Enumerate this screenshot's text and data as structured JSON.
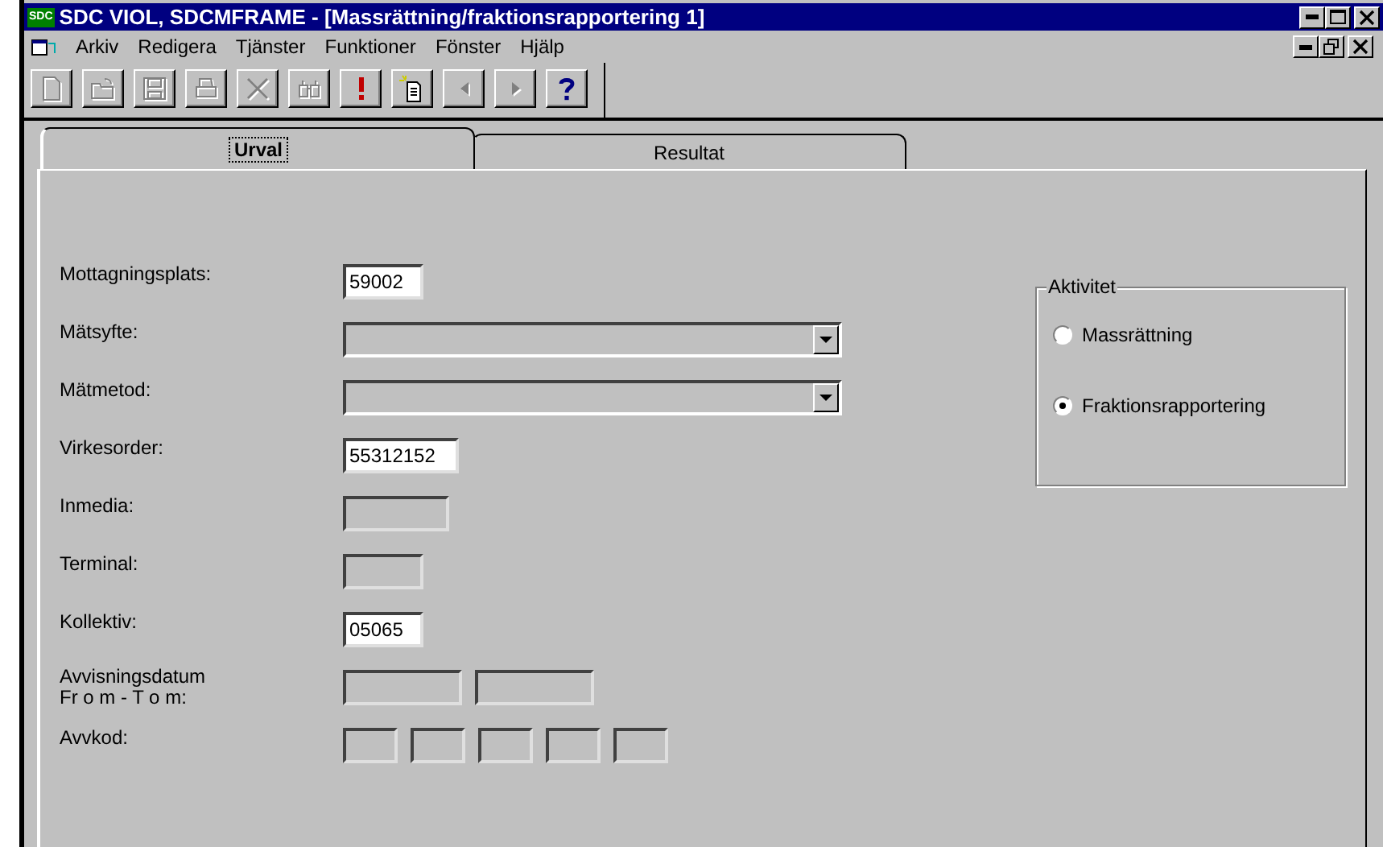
{
  "window": {
    "logo": "SDC",
    "title": "SDC VIOL, SDCMFRAME - [Massrättning/fraktionsrapportering 1]"
  },
  "menu": [
    "Arkiv",
    "Redigera",
    "Tjänster",
    "Funktioner",
    "Fönster",
    "Hjälp"
  ],
  "toolbar": [
    {
      "kind": "new",
      "disabled": true
    },
    {
      "kind": "open",
      "disabled": true
    },
    {
      "kind": "save",
      "disabled": true
    },
    {
      "kind": "print",
      "disabled": true
    },
    {
      "kind": "delete",
      "disabled": true
    },
    {
      "kind": "find",
      "disabled": true
    },
    {
      "kind": "exclaim",
      "disabled": false
    },
    {
      "kind": "newdoc",
      "disabled": false
    },
    {
      "kind": "prev",
      "disabled": true
    },
    {
      "kind": "next",
      "disabled": true
    },
    {
      "kind": "help",
      "disabled": false
    }
  ],
  "tabs": [
    {
      "label": "Urval",
      "selected": true
    },
    {
      "label": "Resultat",
      "selected": false
    }
  ],
  "form": [
    {
      "label": "Mottagningsplats:",
      "kind": "text",
      "fields": [
        {
          "value": "59002",
          "disabled": false
        }
      ]
    },
    {
      "label": "Mätsyfte:",
      "kind": "combo"
    },
    {
      "label": "Mätmetod:",
      "kind": "combo"
    },
    {
      "label": "Virkesorder:",
      "kind": "text",
      "fields": [
        {
          "value": "55312152",
          "disabled": false
        }
      ]
    },
    {
      "label": "Inmedia:",
      "kind": "text",
      "fields": [
        {
          "disabled": true
        }
      ]
    },
    {
      "label": "Terminal:",
      "kind": "text",
      "fields": [
        {
          "disabled": true
        }
      ]
    },
    {
      "label": "Kollektiv:",
      "kind": "text",
      "fields": [
        {
          "value": "05065",
          "disabled": false
        }
      ]
    },
    {
      "label": "Avvisningsdatum\nFr o m - T o m:",
      "kind": "text",
      "fields": [
        {
          "disabled": true
        },
        {
          "disabled": true
        }
      ]
    },
    {
      "label": "Avvkod:",
      "kind": "text",
      "fields": [
        {
          "disabled": true
        },
        {
          "disabled": true
        },
        {
          "disabled": true
        },
        {
          "disabled": true
        },
        {
          "disabled": true
        }
      ]
    }
  ],
  "activity": {
    "title": "Aktivitet",
    "options": [
      {
        "label": "Massrättning",
        "selected": false
      },
      {
        "label": "Fraktionsrapportering",
        "selected": true
      }
    ]
  }
}
